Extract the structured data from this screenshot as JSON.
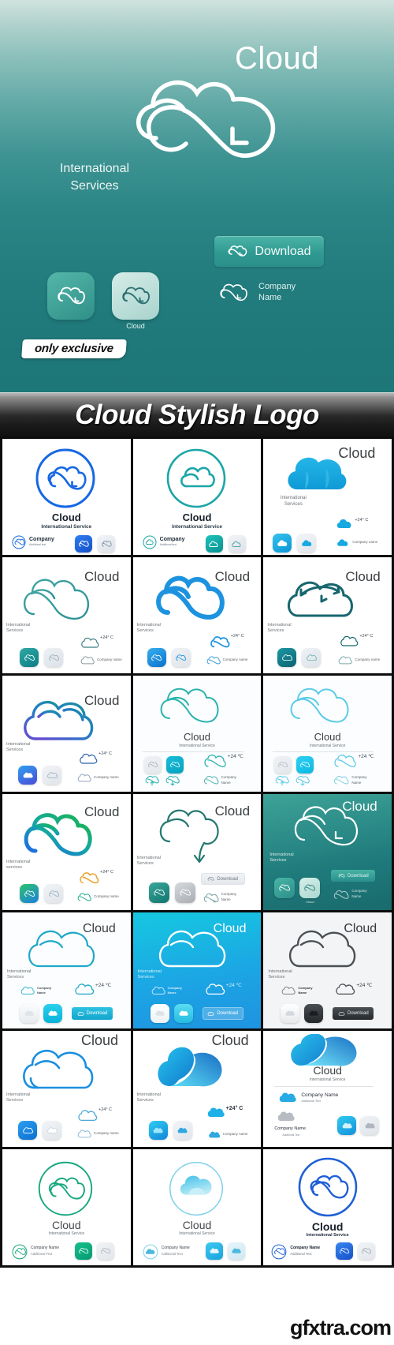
{
  "hero": {
    "title": "Cloud",
    "subtitle": "International\nServices",
    "subtitle_line1": "International",
    "subtitle_line2": "Services",
    "download_label": "Download",
    "icon_caption": "Cloud",
    "company_line1": "Company",
    "company_line2": "Name",
    "gradient_top": "#cfe3de",
    "gradient_bottom": "#1d7678",
    "logo_color": "#ffffff"
  },
  "badge": {
    "label": "only exclusive"
  },
  "banner": {
    "title": "Cloud Stylish Logo",
    "bg_top": "#b9b9b9",
    "bg_bottom": "#111111",
    "text_color": "#ffffff"
  },
  "watermark": {
    "text": "gfxtra.com"
  },
  "labels": {
    "cloud": "Cloud",
    "international_service": "International Service",
    "international_services_l1": "International",
    "international_services_l2": "Services",
    "international_services_lower_l2": "services",
    "company": "Company",
    "company_sub": "Additional text",
    "company_name": "Company Name",
    "company_name_l1": "Company",
    "company_name_l2": "Name",
    "company_name_lower": "Company name",
    "additional_text": "Additional Text",
    "temperature": "+24° C",
    "temperature_alt": "+24 ℃",
    "download": "Download"
  },
  "grid": {
    "columns": 3,
    "rows": 8,
    "cells": [
      {
        "id": 1,
        "style": "circle-outline-blue",
        "bg": "#ffffff",
        "accent": "#1668e3",
        "title": "Cloud",
        "subtitle": "International Service",
        "company": "Company",
        "company_sub": "Additional text",
        "icons": [
          "blue-rounded-icon",
          "gray-rounded-icon"
        ]
      },
      {
        "id": 2,
        "style": "circle-outline-teal",
        "bg": "#ffffff",
        "accent": "#1ba6a8",
        "title": "Cloud",
        "subtitle": "International Service",
        "company": "Company",
        "company_sub": "Additional text",
        "icons": [
          "teal-rounded-icon",
          "gray-rounded-icon"
        ]
      },
      {
        "id": 3,
        "style": "solid-cloud-blue",
        "bg": "#ffffff",
        "accent": "#17a9e0",
        "title": "Cloud",
        "subtitle_l1": "International",
        "subtitle_l2": "Services",
        "temperature": "+24° C",
        "company_name": "Company name",
        "icons": [
          "blue-rounded-icon",
          "gray-rounded-icon"
        ]
      },
      {
        "id": 4,
        "style": "infinity-outline-teal",
        "bg": "#ffffff",
        "accent": "#2d8f93",
        "title": "Cloud",
        "subtitle_l1": "International",
        "subtitle_l2": "Services",
        "temperature": "+24° C",
        "company_name": "Company name",
        "icons": [
          "teal-rounded-icon",
          "gray-rounded-icon"
        ]
      },
      {
        "id": 5,
        "style": "infinity-bold-blue",
        "bg": "#ffffff",
        "accent": "#1d93e0",
        "title": "Cloud",
        "subtitle_l1": "International",
        "subtitle_l2": "Services",
        "temperature": "+24° C",
        "company_name": "Company name",
        "icons": [
          "blue-rounded-icon",
          "gray-rounded-icon"
        ]
      },
      {
        "id": 6,
        "style": "cloud-arrows-dark",
        "bg": "#ffffff",
        "accent": "#17666e",
        "title": "Cloud",
        "subtitle_l1": "International",
        "subtitle_l2": "Services",
        "temperature": "+24° C",
        "company_name": "Company name",
        "icons": [
          "darkteal-rounded-icon",
          "gray-rounded-icon"
        ]
      },
      {
        "id": 7,
        "style": "cloud-outline-gradient",
        "bg": "#ffffff",
        "accent": "#5b4fd0",
        "title": "Cloud",
        "subtitle_l1": "International",
        "subtitle_l2": "Services",
        "temperature": "+24° C",
        "company_name": "Company name",
        "icons": [
          "blueviolet-rounded-icon",
          "gray-rounded-icon"
        ]
      },
      {
        "id": 8,
        "style": "infinity-thin-teal",
        "bg": "#ffffff",
        "accent": "#2bb3ae",
        "title": "Cloud",
        "subtitle": "International Service",
        "temperature": "+24 ℃",
        "company_name_l1": "Company",
        "company_name_l2": "Name",
        "icons": [
          "gray-rounded-icon",
          "cyan-rounded-icon"
        ]
      },
      {
        "id": 9,
        "style": "infinity-thin-skyblue",
        "bg": "#ffffff",
        "accent": "#49c2e3",
        "title": "Cloud",
        "subtitle": "International Service",
        "temperature": "+24 ℃",
        "company_name_l1": "Company",
        "company_name_l2": "Name",
        "icons": [
          "gray-rounded-icon",
          "cyan-rounded-icon"
        ]
      },
      {
        "id": 10,
        "style": "infinity-green-blue",
        "bg": "#ffffff",
        "accent": "#1aa06a",
        "title": "Cloud",
        "subtitle_l1": "International",
        "subtitle_l2": "services",
        "temperature": "+24° C",
        "company_name": "Company name",
        "icons": [
          "green-rounded-icon",
          "gray-rounded-icon"
        ]
      },
      {
        "id": 11,
        "style": "cloud-arrow-down",
        "bg": "#ffffff",
        "accent": "#23786f",
        "title": "Cloud",
        "subtitle_l1": "International",
        "subtitle_l2": "Services",
        "download": "Download",
        "company_name_l1": "Company",
        "company_name_l2": "Name",
        "icons": [
          "teal-rounded-icon",
          "silver-rounded-icon"
        ]
      },
      {
        "id": 12,
        "style": "infinity-on-teal",
        "bg": "#2b8c84",
        "accent": "#ffffff",
        "title": "Cloud",
        "subtitle_l1": "International",
        "subtitle_l2": "Services",
        "download": "Download",
        "company_name_l1": "Company",
        "company_name_l2": "Name",
        "icon_caption": "Cloud",
        "icons": [
          "teal-rounded-icon",
          "lightteal-rounded-icon"
        ]
      },
      {
        "id": 13,
        "style": "cloud-outline-cyan",
        "bg": "#ffffff",
        "accent": "#1fa8c8",
        "title": "Cloud",
        "subtitle_l1": "International",
        "subtitle_l2": "Services",
        "temperature": "+24 ℃",
        "company_name_l1": "Company",
        "company_name_l2": "Name",
        "download": "Download",
        "icons": [
          "white-rounded-icon",
          "cyan-rounded-icon"
        ]
      },
      {
        "id": 14,
        "style": "cloud-outline-on-blue",
        "bg": "#18b4e0",
        "accent": "#ffffff",
        "title": "Cloud",
        "subtitle_l1": "International",
        "subtitle_l2": "Services",
        "temperature": "+24 ℃",
        "company_name_l1": "Company",
        "company_name_l2": "Name",
        "download": "Download",
        "icons": [
          "white-rounded-icon",
          "cyan-rounded-icon"
        ]
      },
      {
        "id": 15,
        "style": "cloud-outline-gray",
        "bg": "#f3f4f5",
        "accent": "#4a4f54",
        "title": "Cloud",
        "subtitle_l1": "International",
        "subtitle_l2": "Services",
        "temperature": "+24 ℃",
        "company_name_l1": "Company",
        "company_name_l2": "Name",
        "download": "Download",
        "icons": [
          "white-rounded-icon",
          "black-rounded-icon"
        ]
      },
      {
        "id": 16,
        "style": "cloud-outline-blue2",
        "bg": "#ffffff",
        "accent": "#1a8fe0",
        "title": "Cloud",
        "subtitle_l1": "International",
        "subtitle_l2": "Services",
        "temperature": "+24° C",
        "company_name": "Company name",
        "icons": [
          "blue-rounded-icon",
          "gray-rounded-icon"
        ]
      },
      {
        "id": 17,
        "style": "solid-gradient-cloud",
        "bg": "#ffffff",
        "accent": "#10b6e8",
        "title": "Cloud",
        "subtitle_l1": "International",
        "subtitle_l2": "Services",
        "temperature": "+24° C",
        "company_name": "Company name",
        "icons": [
          "cyan-rounded-icon",
          "gray-rounded-icon"
        ]
      },
      {
        "id": 18,
        "style": "solid-gradient-wide",
        "bg": "#ffffff",
        "accent": "#17a9e8",
        "title": "Cloud",
        "subtitle": "International Service",
        "company_name": "Company Name",
        "additional_text": "Additional Text",
        "company_name2": "Company Name",
        "additional_text2": "Additional Text",
        "icons": [
          "cyan-rounded-icon",
          "silver-rounded-icon"
        ]
      },
      {
        "id": 19,
        "style": "circle-infinity-green",
        "bg": "#ffffff",
        "accent": "#16a77e",
        "title": "Cloud",
        "subtitle": "International Service",
        "company_name": "Company Name",
        "additional_text": "Additional Text",
        "icons": [
          "green-rounded-icon",
          "gray-rounded-icon"
        ]
      },
      {
        "id": 20,
        "style": "circle-solid-blue",
        "bg": "#ffffff",
        "accent": "#3fb6df",
        "title": "Cloud",
        "subtitle": "International Service",
        "company_name": "Company Name",
        "additional_text": "Additional Text",
        "icons": [
          "cyan-rounded-icon",
          "lightblue-rounded-icon"
        ]
      },
      {
        "id": 21,
        "style": "circle-infinity-blue",
        "bg": "#ffffff",
        "accent": "#1f5fd6",
        "title": "Cloud",
        "subtitle": "International Service",
        "company_name": "Company Name",
        "additional_text": "Additional Text",
        "icons": [
          "blue-rounded-icon",
          "gray-rounded-icon"
        ]
      }
    ]
  }
}
